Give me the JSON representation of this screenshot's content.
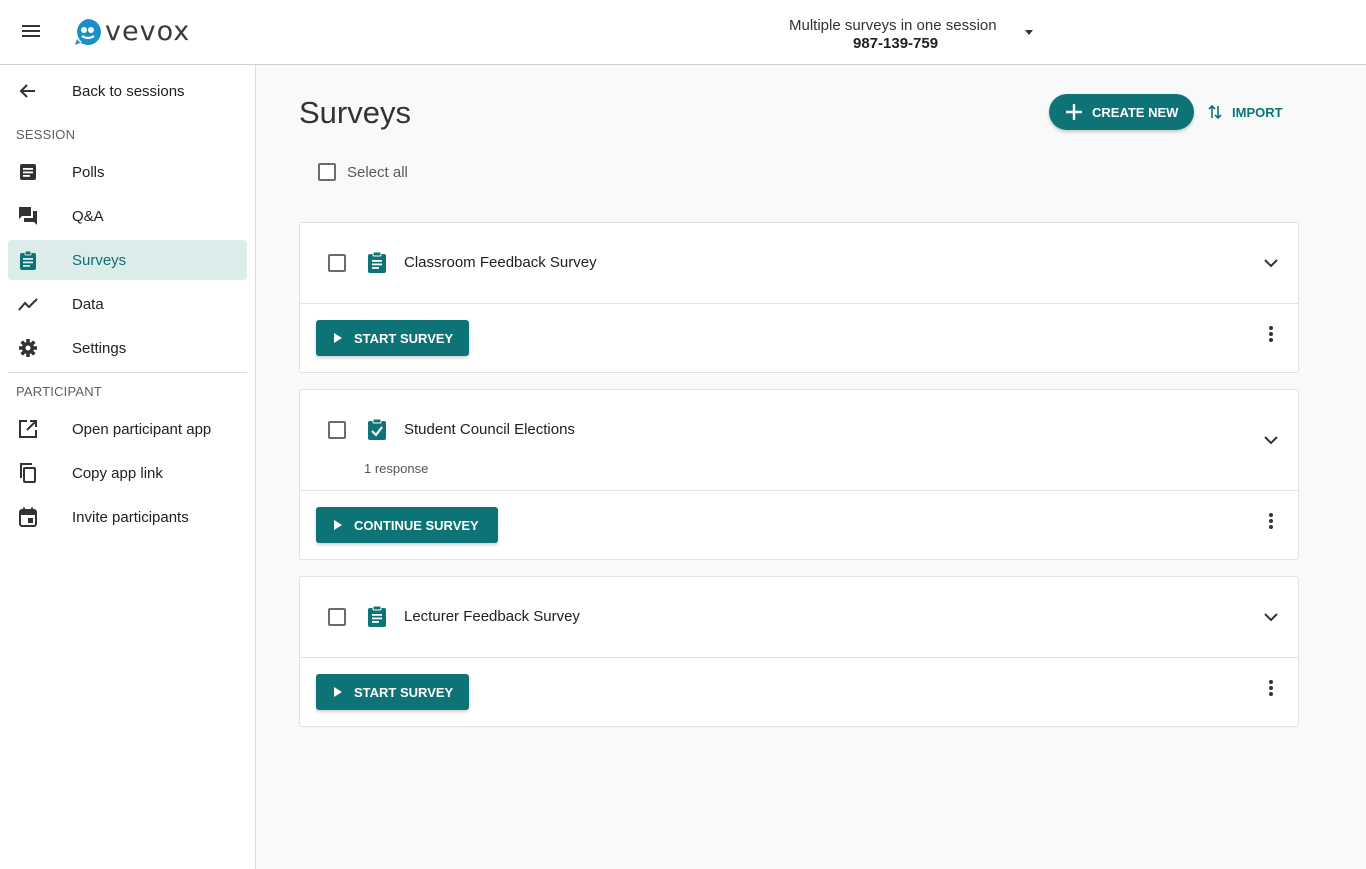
{
  "app": {
    "brand": "vevox",
    "accent": "#0d7377"
  },
  "header": {
    "session_name": "Multiple surveys in one session",
    "session_code": "987-139-759"
  },
  "sidebar": {
    "back_label": "Back to sessions",
    "session_heading": "SESSION",
    "session_items": [
      {
        "label": "Polls",
        "icon": "polls-icon"
      },
      {
        "label": "Q&A",
        "icon": "qa-icon"
      },
      {
        "label": "Surveys",
        "icon": "surveys-icon",
        "active": true
      },
      {
        "label": "Data",
        "icon": "data-icon"
      },
      {
        "label": "Settings",
        "icon": "gear-icon"
      }
    ],
    "participant_heading": "PARTICIPANT",
    "participant_items": [
      {
        "label": "Open participant app",
        "icon": "open-external-icon"
      },
      {
        "label": "Copy app link",
        "icon": "copy-icon"
      },
      {
        "label": "Invite participants",
        "icon": "calendar-icon"
      }
    ]
  },
  "main": {
    "title": "Surveys",
    "create_label": "CREATE NEW",
    "import_label": "IMPORT",
    "select_all_label": "Select all",
    "surveys": [
      {
        "title": "Classroom Feedback Survey",
        "icon": "survey-clipboard-icon",
        "action": "START SURVEY",
        "responses": ""
      },
      {
        "title": "Student Council Elections",
        "icon": "survey-clipboard-check-icon",
        "action": "CONTINUE SURVEY",
        "responses": "1 response"
      },
      {
        "title": "Lecturer Feedback Survey",
        "icon": "survey-clipboard-icon",
        "action": "START SURVEY",
        "responses": ""
      }
    ]
  }
}
